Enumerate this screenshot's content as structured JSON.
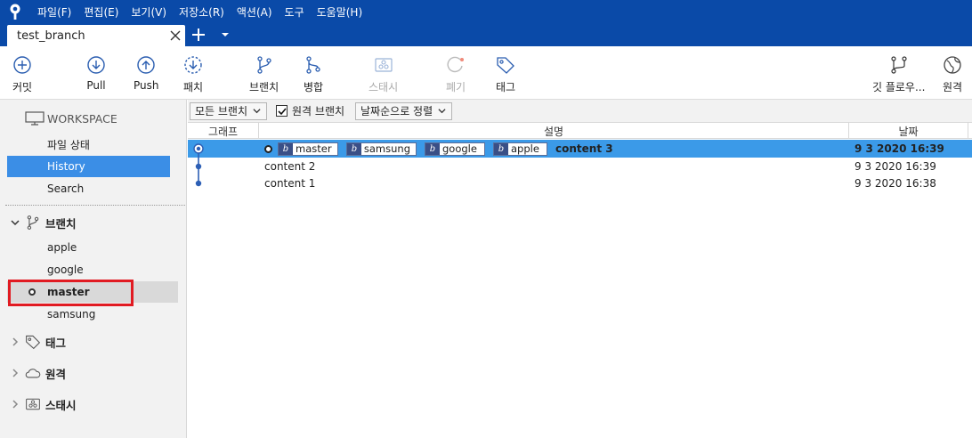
{
  "app": {
    "menu": [
      "파일(F)",
      "편집(E)",
      "보기(V)",
      "저장소(R)",
      "액션(A)",
      "도구",
      "도움말(H)"
    ],
    "tab_title": "test_branch"
  },
  "toolbar": {
    "commit": "커밋",
    "pull": "Pull",
    "push": "Push",
    "fetch": "패치",
    "branch": "브랜치",
    "merge": "병합",
    "stash": "스태시",
    "discard": "폐기",
    "tag": "태그",
    "gitflow": "깃 플로우...",
    "remote": "원격"
  },
  "sidebar": {
    "workspace": "WORKSPACE",
    "workspace_items": [
      "파일 상태",
      "History",
      "Search"
    ],
    "branches_label": "브랜치",
    "branches": [
      "apple",
      "google",
      "master",
      "samsung"
    ],
    "tags_label": "태그",
    "remote_label": "원격",
    "stash_label": "스태시"
  },
  "filters": {
    "branch_filter": "모든 브랜치",
    "remote_branches": "원격 브랜치",
    "sort": "날짜순으로 정렬"
  },
  "columns": {
    "graph": "그래프",
    "description": "설명",
    "date": "날짜"
  },
  "commits": [
    {
      "branches": [
        "master",
        "samsung",
        "google",
        "apple"
      ],
      "message": "content 3",
      "date": "9 3 2020 16:39"
    },
    {
      "message": "content 2",
      "date": "9 3 2020 16:39"
    },
    {
      "message": "content 1",
      "date": "9 3 2020 16:38"
    }
  ],
  "colors": {
    "titlebar": "#0a4aa8",
    "selection": "#3b9ae8",
    "highlight_box": "#e11b22"
  }
}
